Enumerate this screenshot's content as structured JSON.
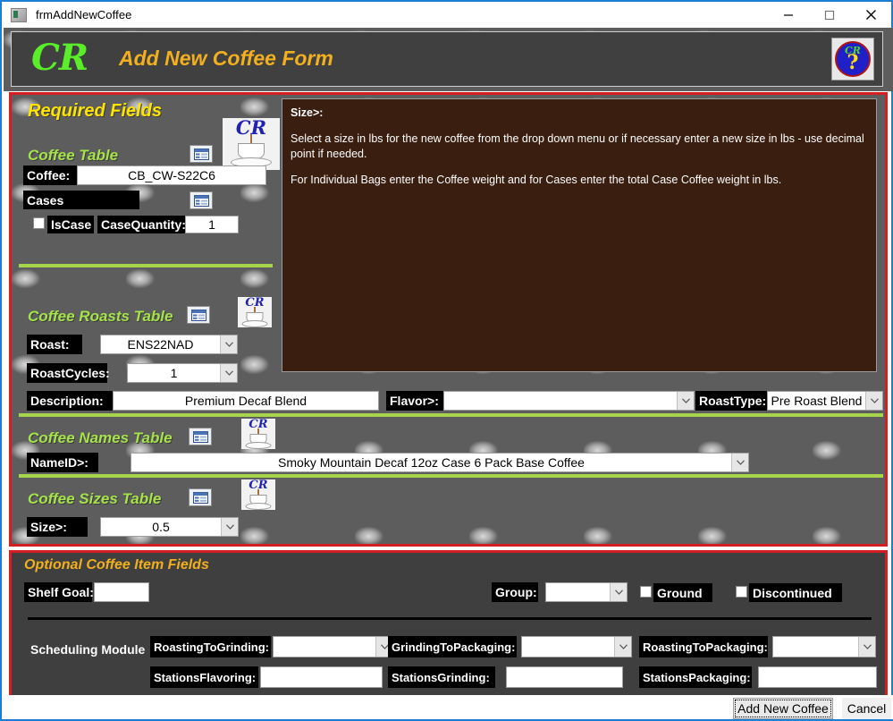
{
  "window": {
    "title": "frmAddNewCoffee",
    "icon": "form-icon",
    "minimize": "minimize-icon",
    "maximize": "maximize-icon",
    "close": "close-icon"
  },
  "header": {
    "logo_text": "CR",
    "title": "Add New Coffee Form",
    "help_cr": "CR",
    "help_mark": "?"
  },
  "required": {
    "panel_title": "Required Fields",
    "coffee_table": {
      "section_title": "Coffee Table",
      "coffee_label": "Coffee:",
      "coffee_value": "CB_CW-S22C6",
      "cases_label": "Cases",
      "iscase_label": "IsCase",
      "iscase_checked": false,
      "casequantity_label": "CaseQuantity:",
      "casequantity_value": "1"
    },
    "roasts_table": {
      "section_title": "Coffee Roasts Table",
      "roast_label": "Roast:",
      "roast_value": "ENS22NAD",
      "roastcycles_label": "RoastCycles:",
      "roastcycles_value": "1",
      "description_label": "Description:",
      "description_value": "Premium Decaf Blend",
      "flavor_label": "Flavor>:",
      "flavor_value": "",
      "roasttype_label": "RoastType:",
      "roasttype_value": "Pre Roast Blend"
    },
    "names_table": {
      "section_title": "Coffee Names Table",
      "nameid_label": "NameID>:",
      "nameid_value": "Smoky Mountain  Decaf 12oz Case 6 Pack Base Coffee"
    },
    "sizes_table": {
      "section_title": "Coffee Sizes Table",
      "size_label": "Size>:",
      "size_value": "0.5"
    }
  },
  "info_panel": {
    "heading": "Size>:",
    "paragraph1": "Select a size in lbs for the new coffee from the drop down menu or if necessary enter a new size in lbs - use decimal point if needed.",
    "paragraph2": "For Individual Bags enter the Coffee weight and for Cases enter the total Case Coffee weight in lbs."
  },
  "optional": {
    "panel_title": "Optional Coffee Item Fields",
    "shelf_goal_label": "Shelf Goal:",
    "shelf_goal_value": "",
    "group_label": "Group:",
    "group_value": "",
    "ground_label": "Ground",
    "ground_checked": false,
    "discontinued_label": "Discontinued",
    "discontinued_checked": false,
    "scheduling_label": "Scheduling Module",
    "roasting_to_grinding_label": "RoastingToGrinding:",
    "roasting_to_grinding_value": "",
    "grinding_to_packaging_label": "GrindingToPackaging:",
    "grinding_to_packaging_value": "",
    "roasting_to_packaging_label": "RoastingToPackaging:",
    "roasting_to_packaging_value": "",
    "stations_flavoring_label": "StationsFlavoring:",
    "stations_flavoring_value": "",
    "stations_grinding_label": "StationsGrinding:",
    "stations_grinding_value": "",
    "stations_packaging_label": "StationsPackaging:",
    "stations_packaging_value": ""
  },
  "footer": {
    "add_label": "Add New Coffee",
    "cancel_label": "Cancel"
  },
  "colors": {
    "accent_red": "#d31f24",
    "header_bg": "#404040",
    "title_gold": "#f2b01e",
    "section_green": "#a6e24b",
    "required_yellow": "#ffe400",
    "info_brown": "#3a1e10",
    "window_border_blue": "#1a7fd4"
  }
}
